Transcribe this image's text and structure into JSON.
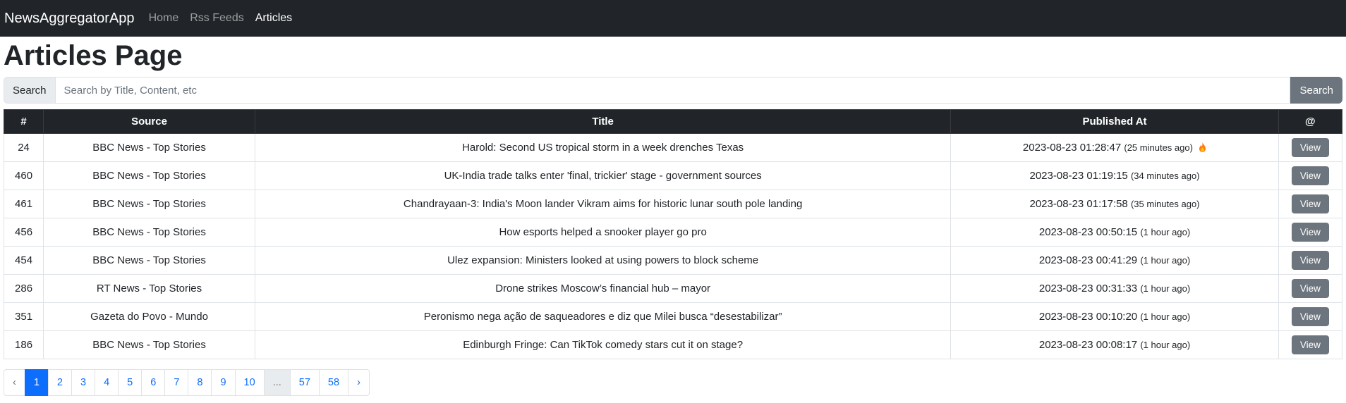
{
  "navbar": {
    "brand": "NewsAggregatorApp",
    "links": [
      {
        "label": "Home"
      },
      {
        "label": "Rss Feeds"
      },
      {
        "label": "Articles"
      }
    ],
    "active_link": "Articles"
  },
  "page_title": "Articles Page",
  "search": {
    "label": "Search",
    "placeholder": "Search by Title, Content, etc",
    "value": "",
    "button_label": "Search"
  },
  "table": {
    "headers": [
      "#",
      "Source",
      "Title",
      "Published At",
      "@"
    ],
    "view_label": "View",
    "rows": [
      {
        "id": "24",
        "source": "BBC News - Top Stories",
        "title": "Harold: Second US tropical storm in a week drenches Texas",
        "published": "2023-08-23 01:28:47",
        "relative": "(25 minutes ago)",
        "hot": true
      },
      {
        "id": "460",
        "source": "BBC News - Top Stories",
        "title": "UK-India trade talks enter 'final, trickier' stage - government sources",
        "published": "2023-08-23 01:19:15",
        "relative": "(34 minutes ago)",
        "hot": false
      },
      {
        "id": "461",
        "source": "BBC News - Top Stories",
        "title": "Chandrayaan-3: India's Moon lander Vikram aims for historic lunar south pole landing",
        "published": "2023-08-23 01:17:58",
        "relative": "(35 minutes ago)",
        "hot": false
      },
      {
        "id": "456",
        "source": "BBC News - Top Stories",
        "title": "How esports helped a snooker player go pro",
        "published": "2023-08-23 00:50:15",
        "relative": "(1 hour ago)",
        "hot": false
      },
      {
        "id": "454",
        "source": "BBC News - Top Stories",
        "title": "Ulez expansion: Ministers looked at using powers to block scheme",
        "published": "2023-08-23 00:41:29",
        "relative": "(1 hour ago)",
        "hot": false
      },
      {
        "id": "286",
        "source": "RT News - Top Stories",
        "title": "Drone strikes Moscow’s financial hub – mayor",
        "published": "2023-08-23 00:31:33",
        "relative": "(1 hour ago)",
        "hot": false
      },
      {
        "id": "351",
        "source": "Gazeta do Povo - Mundo",
        "title": "Peronismo nega ação de saqueadores e diz que Milei busca “desestabilizar”",
        "published": "2023-08-23 00:10:20",
        "relative": "(1 hour ago)",
        "hot": false
      },
      {
        "id": "186",
        "source": "BBC News - Top Stories",
        "title": "Edinburgh Fringe: Can TikTok comedy stars cut it on stage?",
        "published": "2023-08-23 00:08:17",
        "relative": "(1 hour ago)",
        "hot": false
      }
    ]
  },
  "pagination": {
    "items": [
      {
        "label": "‹",
        "state": "muted"
      },
      {
        "label": "1",
        "state": "active"
      },
      {
        "label": "2",
        "state": ""
      },
      {
        "label": "3",
        "state": ""
      },
      {
        "label": "4",
        "state": ""
      },
      {
        "label": "5",
        "state": ""
      },
      {
        "label": "6",
        "state": ""
      },
      {
        "label": "7",
        "state": ""
      },
      {
        "label": "8",
        "state": ""
      },
      {
        "label": "9",
        "state": ""
      },
      {
        "label": "10",
        "state": ""
      },
      {
        "label": "...",
        "state": "disabled"
      },
      {
        "label": "57",
        "state": ""
      },
      {
        "label": "58",
        "state": ""
      },
      {
        "label": "›",
        "state": ""
      }
    ]
  },
  "colors": {
    "navbar_bg": "#212529",
    "secondary": "#6c757d",
    "primary": "#0d6efd",
    "fire": "#fd7e14"
  }
}
